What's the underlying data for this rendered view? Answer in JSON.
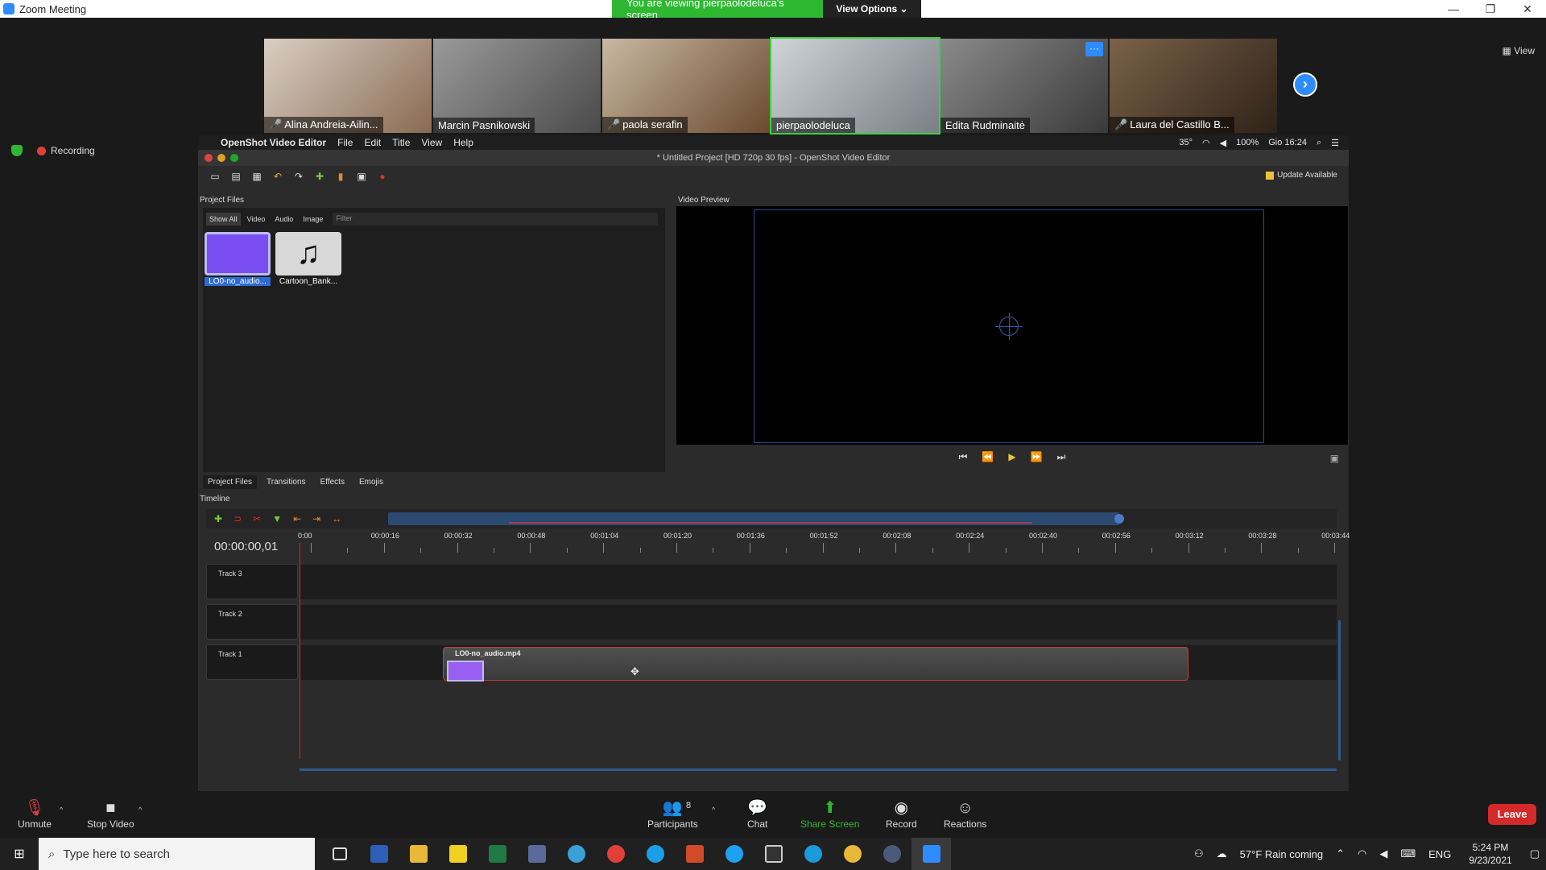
{
  "zoom": {
    "window_title": "Zoom Meeting",
    "viewing_banner": "You are viewing pierpaolodeluca's screen",
    "view_options": "View Options ⌄",
    "view_button": "View",
    "recording": "Recording",
    "participants_thumbs": [
      {
        "name": "Alina Andreia-Ailin...",
        "muted": true
      },
      {
        "name": "Marcin Pasnikowski",
        "muted": false
      },
      {
        "name": "paola serafin",
        "muted": true
      },
      {
        "name": "pierpaolodeluca",
        "muted": false,
        "active": true
      },
      {
        "name": "Edita Rudminaitė",
        "muted": false
      },
      {
        "name": "Laura del Castillo B...",
        "muted": true
      }
    ],
    "more_button": "···",
    "controls": {
      "unmute": "Unmute",
      "stop_video": "Stop Video",
      "participants": "Participants",
      "participants_count": "8",
      "chat": "Chat",
      "share_screen": "Share Screen",
      "record": "Record",
      "reactions": "Reactions",
      "leave": "Leave"
    }
  },
  "mac": {
    "app_name": "OpenShot Video Editor",
    "menus": [
      "File",
      "Edit",
      "Title",
      "View",
      "Help"
    ],
    "status": [
      "35°",
      "100%",
      "Gio 16:24"
    ]
  },
  "openshot": {
    "window_title": "* Untitled Project [HD 720p 30 fps] - OpenShot Video Editor",
    "update_available": "Update Available",
    "project_files_title": "Project Files",
    "filters": [
      "Show All",
      "Video",
      "Audio",
      "Image"
    ],
    "filter_placeholder": "Filter",
    "files": [
      {
        "label": "LO0-no_audio...",
        "kind": "video"
      },
      {
        "label": "Cartoon_Bank...",
        "kind": "audio"
      }
    ],
    "video_preview_title": "Video Preview",
    "bottom_tabs": [
      "Project Files",
      "Transitions",
      "Effects",
      "Emojis"
    ],
    "timeline_title": "Timeline",
    "time_display": "00:00:00,01",
    "ruler_labels": [
      "0:00",
      "00:00:16",
      "00:00:32",
      "00:00:48",
      "00:01:04",
      "00:01:20",
      "00:01:36",
      "00:01:52",
      "00:02:08",
      "00:02:24",
      "00:02:40",
      "00:02:56",
      "00:03:12",
      "00:03:28",
      "00:03:44"
    ],
    "tracks": [
      "Track 3",
      "Track 2",
      "Track 1"
    ],
    "clip_name": "LO0-no_audio.mp4"
  },
  "taskbar": {
    "search_placeholder": "Type here to search",
    "weather": "57°F  Rain coming",
    "language": "ENG",
    "time": "5:24 PM",
    "date": "9/23/2021"
  }
}
